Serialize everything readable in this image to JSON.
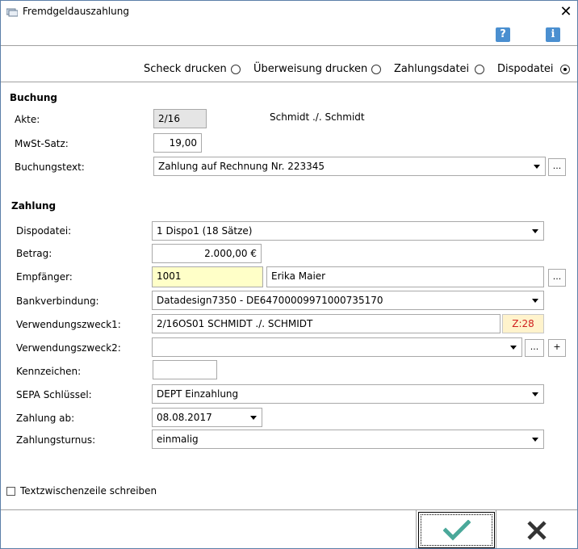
{
  "window": {
    "title": "Fremdgeldauszahlung"
  },
  "top_icons": {
    "help": "?",
    "info": "i"
  },
  "mode_options": [
    {
      "label": "Scheck drucken",
      "selected": false
    },
    {
      "label": "Überweisung drucken",
      "selected": false
    },
    {
      "label": "Zahlungsdatei",
      "selected": false
    },
    {
      "label": "Dispodatei",
      "selected": true
    }
  ],
  "buchung": {
    "title": "Buchung",
    "akte_label": "Akte:",
    "akte_value": "2/16",
    "akte_name": "Schmidt ./. Schmidt",
    "mwst_label": "MwSt-Satz:",
    "mwst_value": "19,00",
    "text_label": "Buchungstext:",
    "text_value": "Zahlung auf Rechnung Nr. 223345",
    "text_more": "..."
  },
  "zahlung": {
    "title": "Zahlung",
    "dispodatei_label": "Dispodatei:",
    "dispodatei_value": "1  Dispo1 (18 Sätze)",
    "betrag_label": "Betrag:",
    "betrag_value": "2.000,00 €",
    "empfaenger_label": "Empfänger:",
    "empfaenger_id": "1001",
    "empfaenger_name": "Erika Maier",
    "empfaenger_more": "...",
    "bank_label": "Bankverbindung:",
    "bank_value": "Datadesign7350 - DE64700009971000735170",
    "vz1_label": "Verwendungszweck1:",
    "vz1_value": "2/16OS01 SCHMIDT ./. SCHMIDT",
    "vz1_count": "Z:28",
    "vz2_label": "Verwendungszweck2:",
    "vz2_value": "",
    "vz2_more": "...",
    "vz2_add": "+",
    "kennzeichen_label": "Kennzeichen:",
    "kennzeichen_value": "",
    "sepa_label": "SEPA Schlüssel:",
    "sepa_value": "DEPT Einzahlung",
    "zahlung_ab_label": "Zahlung ab:",
    "zahlung_ab_value": "08.08.2017",
    "turnus_label": "Zahlungsturnus:",
    "turnus_value": "einmalig"
  },
  "footer": {
    "checkbox_label": "Textzwischenzeile schreiben",
    "checkbox_checked": false
  },
  "colors": {
    "ok_check": "#4aa89a",
    "cancel_x": "#333333",
    "z_count": "#d02020",
    "yellow_field": "#ffffc8"
  }
}
